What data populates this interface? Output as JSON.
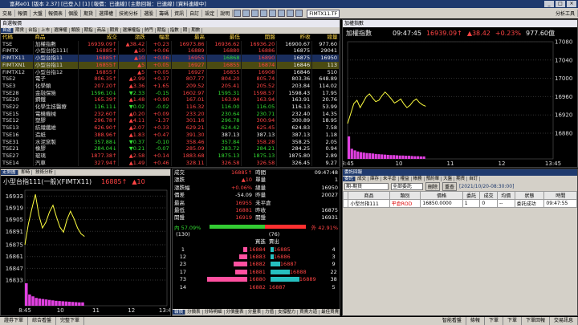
{
  "window": {
    "title": "富邦e01 [版本 2.37] [已登入] [1] [報價：已連線] [主動回報：已連線] [資料連線中]",
    "buttons": [
      "_",
      "□",
      "×"
    ]
  },
  "menubar": {
    "items": [
      "交易",
      "報價",
      "大盤",
      "報價表",
      "個股",
      "期貨",
      "選擇權",
      "技術分析",
      "選股",
      "籌碼",
      "資訊",
      "自訂",
      "設定",
      "說明"
    ],
    "code_value": "FIMTX11.TF",
    "analysis_label": "分析工具"
  },
  "quote": {
    "head": "自選報價",
    "tabs": [
      "自選",
      "期貨",
      "台指",
      "上市",
      "選擇權",
      "類股",
      "期指",
      "商品",
      "期貨",
      "選擇權指",
      "熱門",
      "期指",
      "指數",
      "期",
      "期數"
    ],
    "columns": [
      "代碼",
      "商品",
      "成交",
      "漲跌",
      "幅度",
      "最高",
      "最低",
      "開盤",
      "昨收",
      "總量"
    ],
    "rows": [
      [
        "TSE",
        "加權指數",
        "16939.09↑",
        "▲38.42",
        "+0.23",
        "16973.86",
        "16936.62",
        "16936.20",
        "16900.67",
        "977.60"
      ],
      [
        "FIMTX",
        "小型台指111(",
        "16885↑",
        "▲10",
        "+0.06",
        "16889",
        "16880",
        "16886",
        "16875",
        "29041"
      ],
      [
        "FIMTX11",
        "小型台指11",
        "16885↑",
        "▲10",
        "+0.06",
        "16955",
        "16868",
        "16890",
        "16875",
        "16950"
      ],
      [
        "FIMTXN1",
        "小型台指11",
        "16855↑",
        "▲5",
        "+0.05",
        "16927",
        "16855",
        "16874",
        "16846",
        "113"
      ],
      [
        "FIMTX12",
        "小型台指12",
        "16855↑",
        "▲5",
        "+0.05",
        "16927",
        "16855",
        "16908",
        "16846",
        "510"
      ],
      [
        "TSE2",
        "電子",
        "806.35↑",
        "▲2.99",
        "+0.37",
        "807.77",
        "804.20",
        "805.74",
        "803.36",
        "648.89"
      ],
      [
        "TSE3",
        "化學類",
        "207.20↑",
        "▲3.36",
        "+1.65",
        "209.52",
        "205.41",
        "205.52",
        "203.84",
        "114.02"
      ],
      [
        "TSE28",
        "金融保險",
        "1596.10↓",
        "▼2.33",
        "-0.15",
        "1602.97",
        "1595.31",
        "1598.57",
        "1598.43",
        "17.95"
      ],
      [
        "TSE20",
        "鋼鐵",
        "165.39↑",
        "▲1.48",
        "+0.90",
        "167.01",
        "163.94",
        "163.94",
        "163.91",
        "20.76"
      ],
      [
        "TSE22",
        "化學生技醫療",
        "116.11↓",
        "▼0.02",
        "-0.02",
        "116.32",
        "116.00",
        "116.05",
        "116.13",
        "53.99"
      ],
      [
        "TSE15",
        "電機機械",
        "232.60↑",
        "▲0.20",
        "+0.09",
        "233.20",
        "230.64",
        "230.71",
        "232.40",
        "14.35"
      ],
      [
        "TSE12",
        "塑膠",
        "296.78↑",
        "▲4.11",
        "-1.37",
        "301.16",
        "296.78",
        "300.94",
        "300.89",
        "18.95"
      ],
      [
        "TSE13",
        "紡織纖維",
        "626.90↑",
        "▲2.07",
        "+0.33",
        "629.21",
        "624.42",
        "625.45",
        "624.83",
        "7.58"
      ],
      [
        "TSE16",
        "造紙",
        "388.96↑",
        "▲1.83",
        "+0.47",
        "391.30",
        "387.13",
        "387.13",
        "387.13",
        "1.18"
      ],
      [
        "TSE31",
        "水泥窯製",
        "357.88↓",
        "▼0.37",
        "-0.10",
        "358.46",
        "357.84",
        "358.28",
        "358.25",
        "2.05"
      ],
      [
        "TSE21",
        "橡膠",
        "284.04↓",
        "▼0.21",
        "-0.07",
        "285.09",
        "283.72",
        "284.21",
        "284.25",
        "0.94"
      ],
      [
        "TSE27",
        "玻璃",
        "1877.38↑",
        "▲2.58",
        "+0.14",
        "1883.68",
        "1875.13",
        "1875.13",
        "1875.80",
        "2.89"
      ],
      [
        "TSE14",
        "汽車",
        "327.94↑",
        "▲1.49",
        "+0.46",
        "328.11",
        "326.58",
        "326.58",
        "326.45",
        "9.27"
      ]
    ]
  },
  "index_chart": {
    "head": "加權指數",
    "title": "加權指數",
    "time": "09:47:45",
    "price": "16939.09↑",
    "change": "▲38.42",
    "pct": "+0.23%",
    "volume": "977.60億",
    "chart_data": {
      "type": "line",
      "x_ticks": [
        "8:45",
        "10",
        "11",
        "12",
        "13:45"
      ],
      "y_ticks": [
        "17080",
        "17040",
        "17000",
        "16960",
        "16920",
        "16880"
      ],
      "ylim": [
        16880,
        17080
      ],
      "series": [
        {
          "values": [
            16901,
            16923,
            16945,
            16952,
            16936,
            16948,
            16960,
            16966,
            16957,
            16949,
            16952,
            16962,
            16970,
            16963,
            16955,
            16946,
            16950,
            16955,
            16944,
            16936,
            16941,
            16950,
            16955,
            16947,
            16942,
            16939
          ]
        }
      ],
      "volume": [
        1,
        0.45,
        0.38,
        0.33,
        0.3,
        0.28,
        0.26,
        0.25,
        0.24,
        0.22,
        0.21,
        0.2,
        0.19,
        0.18,
        0.17,
        0.17,
        0.16,
        0.15,
        0.15,
        0.14,
        0.14,
        0.13,
        0.12,
        0.12,
        0.11,
        0.11
      ]
    }
  },
  "fut_chart": {
    "head": "走勢圖",
    "tabs": [
      "即時",
      "技術分析"
    ],
    "title": "小型台指111(一般)(FIMTX11)",
    "price": "16885↑",
    "change": "▲10",
    "chart_data": {
      "type": "line",
      "x_ticks": [
        "8:45",
        "10",
        "11",
        "12",
        "13:45"
      ],
      "y_ticks": [
        "16933",
        "16919",
        "16905",
        "16891",
        "16875",
        "16861",
        "16847",
        "16833"
      ],
      "ylim": [
        16833,
        16940
      ],
      "series": [
        {
          "values": [
            16875,
            16900,
            16918,
            16935,
            16910,
            16895,
            16902,
            16914,
            16922,
            16908,
            16896,
            16890,
            16905,
            16915,
            16906,
            16895,
            16888,
            16885
          ]
        }
      ],
      "volume": [
        1,
        0.5,
        0.42,
        0.35,
        0.32,
        0.3,
        0.28,
        0.26,
        0.24,
        0.22,
        0.21,
        0.2,
        0.19,
        0.18,
        0.17,
        0.16,
        0.15,
        0.15
      ]
    }
  },
  "detail": {
    "rows": [
      [
        "成交",
        "16885↑",
        "時間",
        "09:47:48"
      ],
      [
        "漲跌",
        "▲10",
        "單量",
        "1"
      ],
      [
        "漲跌幅",
        "+0.06%",
        "總量",
        "16950"
      ],
      [
        "價差",
        "-54.09",
        "昨量",
        "20027"
      ],
      [
        "最高",
        "16955",
        "未平倉",
        ""
      ],
      [
        "最低",
        "16881",
        "昨收",
        "16875"
      ],
      [
        "開盤",
        "16919",
        "開盤",
        "16931"
      ]
    ],
    "bar_left": "內 57.09%",
    "bar_right": "外 42.91%",
    "bar_pct": 57.09,
    "totals": [
      "(130)",
      "",
      "(76)"
    ],
    "book_head": [
      "",
      "買進",
      "賣出",
      ""
    ],
    "book": [
      [
        "1",
        "16884",
        "16885",
        "4"
      ],
      [
        "12",
        "16883",
        "16886",
        "3"
      ],
      [
        "23",
        "16882",
        "16887",
        "9"
      ],
      [
        "17",
        "16881",
        "16888",
        "22"
      ],
      [
        "73",
        "16880",
        "16889",
        "38"
      ]
    ],
    "book_foot": [
      "14",
      "16882",
      "16887",
      "5"
    ],
    "buy_bars": [
      0.1,
      0.2,
      0.35,
      0.3,
      1
    ],
    "sell_bars": [
      0.1,
      0.1,
      0.3,
      0.6,
      0.9
    ],
    "bottom_tabs": [
      "報價",
      "分價表",
      "分時明細",
      "分價量表",
      "分量表",
      "力值",
      "支撐壓力",
      "買賣力道",
      "最佳買賣"
    ]
  },
  "order": {
    "head": "委託回報",
    "tabs": [
      "委託",
      "成交",
      "庫存",
      "未平倉",
      "權益",
      "帳務",
      "預約單",
      "大盤",
      "期貨",
      "自訂"
    ],
    "account_value": "期-期貨",
    "kind_value": "全部委託",
    "delete_label": "刪除",
    "query_label": "重查",
    "time_filter": "[2021/10/20-08:30:00]",
    "columns": [
      "",
      "商品",
      "類別",
      "價格",
      "委託",
      "成交",
      "均價",
      "狀態",
      "時間"
    ],
    "rows": [
      [
        "",
        "小型台指111",
        "平倉ROD",
        "16850.0000",
        "1",
        "0",
        "--",
        "委託成功",
        "09:47:55"
      ]
    ]
  },
  "statusbar": [
    "證券下單",
    "綜合看盤",
    "完整下單",
    "智能看盤",
    "條報",
    "下單",
    "下單",
    "下單回報",
    "交易訊息"
  ]
}
